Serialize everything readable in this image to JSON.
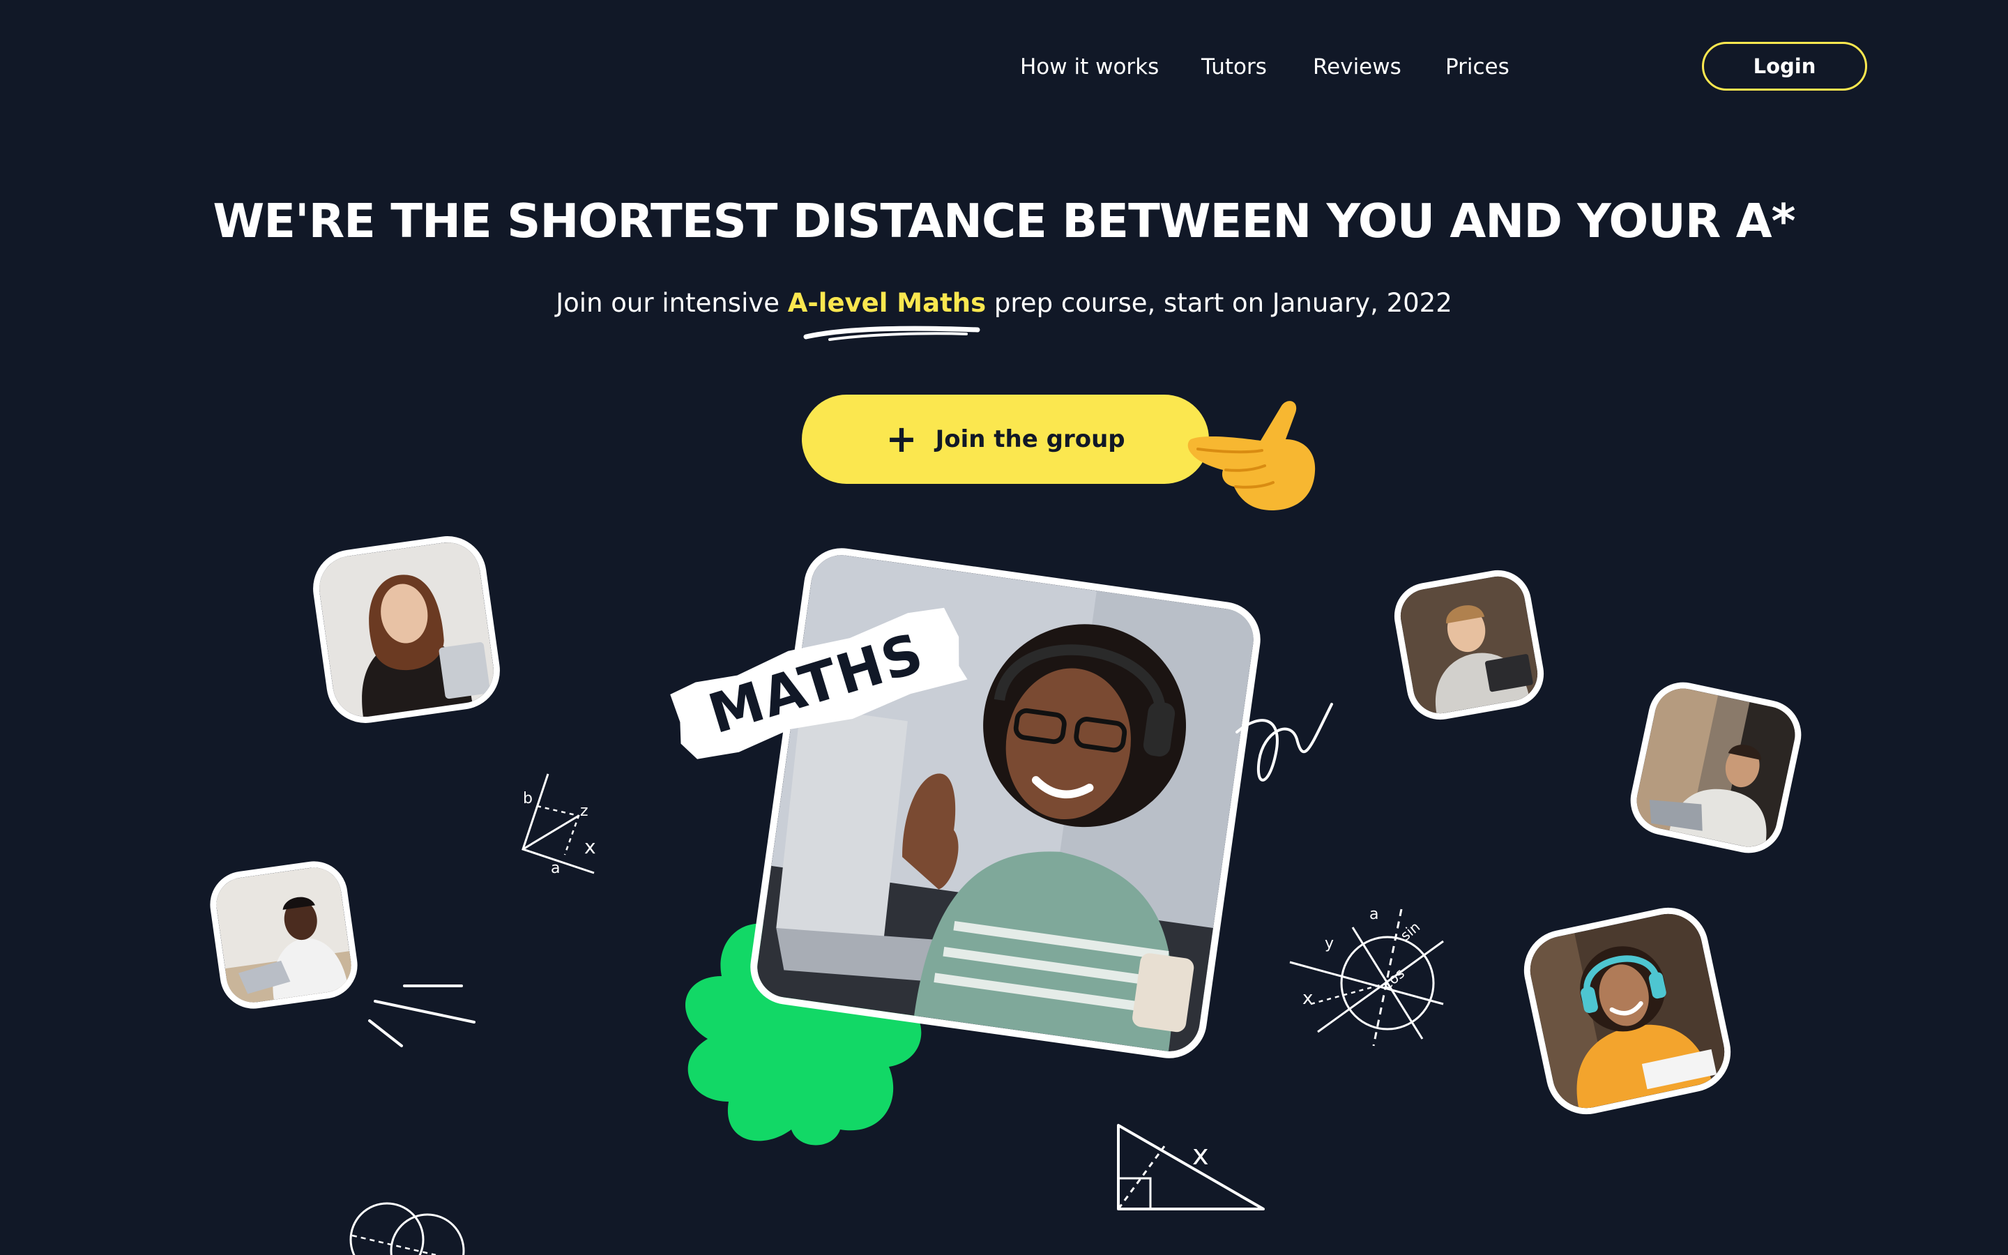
{
  "nav": {
    "links": [
      "How it works",
      "Tutors",
      "Reviews",
      "Prices"
    ],
    "login_label": "Login"
  },
  "hero": {
    "title": "WE'RE THE SHORTEST DISTANCE BETWEEN YOU AND YOUR A*",
    "subtitle_before": "Join our intensive ",
    "subtitle_highlight": "A-level Maths",
    "subtitle_after": " prep course, start on January, 2022",
    "cta_label": "Join the group",
    "cta_icon": "plus-icon",
    "pointer_icon": "pointing-hand-emoji"
  },
  "feature": {
    "tag_label": "MATHS",
    "photo_subject": "student-waving-at-laptop"
  },
  "photos": [
    "student-girl-with-laptop",
    "student-boy-at-desk",
    "student-boy-smiling",
    "student-man-typing",
    "student-girl-with-headphones"
  ],
  "doodles": {
    "axes_labels": [
      "b",
      "z",
      "x",
      "a"
    ],
    "circle_labels": [
      "a",
      "y",
      "sin",
      "cos",
      "x"
    ],
    "triangle_label": "x"
  },
  "colors": {
    "background": "#111827",
    "accent_yellow": "#fbe74f",
    "accent_green": "#12d866",
    "text": "#ffffff"
  }
}
